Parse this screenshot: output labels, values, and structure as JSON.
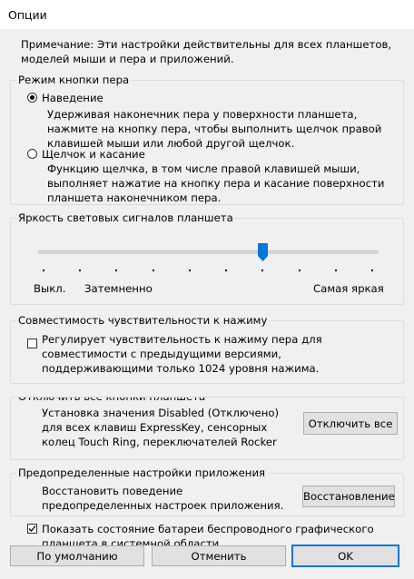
{
  "window": {
    "title": "Опции"
  },
  "note": "Примечание: Эти настройки действительны для всех планшетов, моделей мыши и пера и приложений.",
  "pen_mode": {
    "legend": "Режим кнопки пера",
    "options": [
      {
        "label": "Наведение",
        "description": "Удерживая наконечник пера у поверхности планшета, нажмите на кнопку пера, чтобы выполнить щелчок правой клавишей мыши или любой другой щелчок.",
        "selected": true
      },
      {
        "label": "Щелчок и касание",
        "description": "Функцию щелчка, в том числе правой клавишей мыши, выполняет нажатие на кнопку пера и касание поверхности планшета наконечником пера.",
        "selected": false
      }
    ]
  },
  "brightness": {
    "legend": "Яркость световых сигналов планшета",
    "min_label": "Выкл.",
    "mid_label": "Затемненно",
    "max_label": "Самая яркая",
    "tick_count": 10,
    "value_fraction": 0.667,
    "accent": "#0078d7"
  },
  "compat": {
    "legend": "Совместимость чувствительности к нажиму",
    "checkbox_label": "Регулирует чувствительность к нажиму пера для совместимости с предыдущими версиями, поддерживающими только 1024 уровня нажима.",
    "checked": false
  },
  "disable_buttons": {
    "legend": "Отключить все кнопки планшета",
    "description": "Установка значения Disabled (Отключено) для всех клавиш ExpressKey, сенсорных колец Touch Ring, переключателей Rocker Ring и сенсорных полос Touch Strip.",
    "button_label": "Отключить все"
  },
  "presets": {
    "legend": "Предопределенные настройки приложения",
    "description": "Восстановить поведение предопределенных настроек приложения.",
    "button_label": "Восстановление"
  },
  "battery": {
    "checkbox_label": "Показать состояние батареи беспроводного графического планшета в системной области",
    "checked": true
  },
  "footer": {
    "default_label": "По умолчанию",
    "cancel_label": "Отменить",
    "ok_label": "OK"
  }
}
